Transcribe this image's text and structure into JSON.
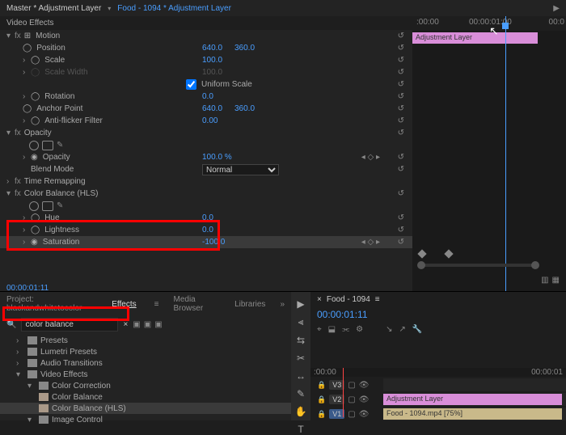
{
  "tabs": {
    "master": "Master * Adjustment Layer",
    "food": "Food - 1094 * Adjustment Layer"
  },
  "panel": {
    "video_effects": "Video Effects"
  },
  "motion": {
    "title": "Motion",
    "position": "Position",
    "pos_x": "640.0",
    "pos_y": "360.0",
    "scale": "Scale",
    "scale_v": "100.0",
    "scale_width": "Scale Width",
    "scale_width_v": "100.0",
    "uniform": "Uniform Scale",
    "rotation": "Rotation",
    "rotation_v": "0.0",
    "anchor": "Anchor Point",
    "anchor_x": "640.0",
    "anchor_y": "360.0",
    "flicker": "Anti-flicker Filter",
    "flicker_v": "0.00"
  },
  "opacity": {
    "title": "Opacity",
    "label": "Opacity",
    "value": "100.0 %",
    "blend": "Blend Mode",
    "blend_v": "Normal"
  },
  "time": {
    "title": "Time Remapping"
  },
  "cb": {
    "title": "Color Balance (HLS)",
    "hue": "Hue",
    "hue_v": "0.0",
    "light": "Lightness",
    "light_v": "0.0",
    "sat": "Saturation",
    "sat_v": "-100.0"
  },
  "timecode": "00:00:01:11",
  "timeline": {
    "t1": ":00:00",
    "t2": "00:00:01:00",
    "t3": "00:0",
    "clip": "Adjustment Layer"
  },
  "project": {
    "name": "Project: blackandwhitetocolor",
    "effects": "Effects",
    "media": "Media Browser",
    "libraries": "Libraries",
    "search": "color balance",
    "presets": "Presets",
    "lumetri": "Lumetri Presets",
    "audio": "Audio Transitions",
    "video": "Video Effects",
    "cc": "Color Correction",
    "cb1": "Color Balance",
    "cb2": "Color Balance (HLS)",
    "img": "Image Control"
  },
  "program": {
    "title": "Food - 1094",
    "time": "00:00:01:11",
    "r1": ":00:00",
    "r2": "00:00:01",
    "adj": "Adjustment Layer",
    "food": "Food - 1094.mp4 [75%]"
  },
  "tracks": {
    "v3": "V3",
    "v2": "V2",
    "v1": "V1"
  }
}
